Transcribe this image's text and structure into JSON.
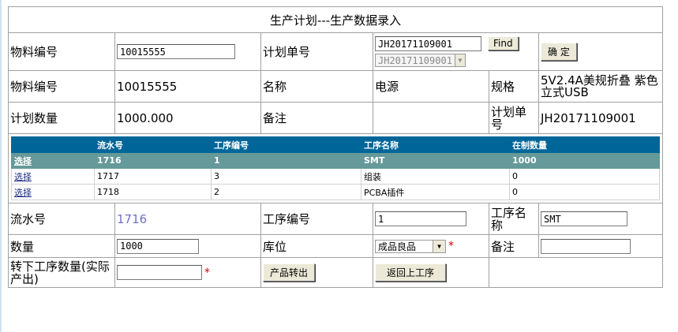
{
  "title": "生产计划---生产数据录入",
  "query": {
    "material_label": "物料编号",
    "material_value": "10015555",
    "plan_label": "计划单号",
    "plan_value": "JH20171109001",
    "plan_select": "JH20171109001",
    "find_button": "Find",
    "confirm_button": "确 定"
  },
  "info": {
    "material_label": "物料编号",
    "material_value": "10015555",
    "name_label": "名称",
    "name_value": "电源",
    "spec_label": "规格",
    "spec_value": "5V2.4A美规折叠 紫色立式USB",
    "qty_label": "计划数量",
    "qty_value": "1000.000",
    "remark_label": "备注",
    "remark_value": "",
    "plan_label": "计划单号",
    "plan_value": "JH20171109001"
  },
  "grid": {
    "headers": [
      "",
      "流水号",
      "工序编号",
      "工序名称",
      "在制数量"
    ],
    "rows": [
      {
        "action": "选择",
        "serial": "1716",
        "proc_no": "1",
        "proc_name": "SMT",
        "wip": "1000"
      },
      {
        "action": "选择",
        "serial": "1717",
        "proc_no": "3",
        "proc_name": "组装",
        "wip": "0"
      },
      {
        "action": "选择",
        "serial": "1718",
        "proc_no": "2",
        "proc_name": "PCBA插件",
        "wip": "0"
      }
    ]
  },
  "form": {
    "serial_label": "流水号",
    "serial_value": "1716",
    "proc_no_label": "工序编号",
    "proc_no_value": "1",
    "proc_name_label": "工序名称",
    "proc_name_value": "SMT",
    "qty_label": "数量",
    "qty_value": "1000",
    "loc_label": "库位",
    "loc_value": "成品良品",
    "remark_label": "备注",
    "remark_value": "",
    "transfer_label": "转下工序数量(实际产出)",
    "transfer_value": "",
    "required_mark": "*",
    "output_button": "产品转出",
    "back_button": "返回上工序"
  },
  "colors": {
    "grid_header": "#006699",
    "grid_selected": "#669999",
    "required": "#d00000"
  }
}
